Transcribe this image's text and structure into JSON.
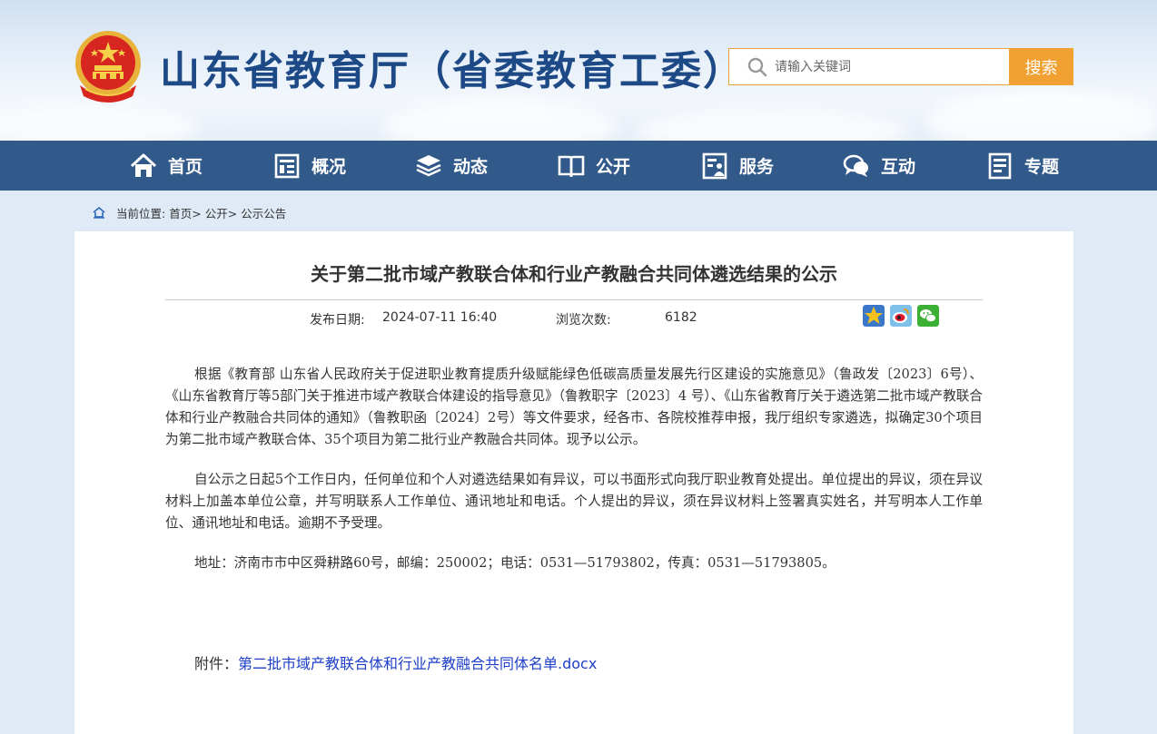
{
  "header": {
    "site_title": "山东省教育厅（省委教育工委）",
    "search_placeholder": "请输入关键词",
    "search_button": "搜索"
  },
  "nav": [
    {
      "label": "首页",
      "icon": "home-icon"
    },
    {
      "label": "概况",
      "icon": "overview-icon"
    },
    {
      "label": "动态",
      "icon": "layers-icon"
    },
    {
      "label": "公开",
      "icon": "book-icon"
    },
    {
      "label": "服务",
      "icon": "service-icon"
    },
    {
      "label": "互动",
      "icon": "chat-icon"
    },
    {
      "label": "专题",
      "icon": "document-icon"
    }
  ],
  "breadcrumb": {
    "prefix": "当前位置:",
    "items": [
      "首页>",
      "公开>",
      "公示公告"
    ]
  },
  "article": {
    "title": "关于第二批市域产教联合体和行业产教融合共同体遴选结果的公示",
    "date_label": "发布日期:",
    "date_value": "2024-07-11 16:40",
    "views_label": "浏览次数:",
    "views_value": "6182",
    "paragraphs": [
      "根据《教育部 山东省人民政府关于促进职业教育提质升级赋能绿色低碳高质量发展先行区建设的实施意见》（鲁政发〔2023〕6号）、《山东省教育厅等5部门关于推进市域产教联合体建设的指导意见》（鲁教职字〔2023〕4 号）、《山东省教育厅关于遴选第二批市域产教联合体和行业产教融合共同体的通知》（鲁教职函〔2024〕2号）等文件要求，经各市、各院校推荐申报，我厅组织专家遴选，拟确定30个项目为第二批市域产教联合体、35个项目为第二批行业产教融合共同体。现予以公示。",
      "自公示之日起5个工作日内，任何单位和个人对遴选结果如有异议，可以书面形式向我厅职业教育处提出。单位提出的异议，须在异议材料上加盖本单位公章，并写明联系人工作单位、通讯地址和电话。个人提出的异议，须在异议材料上签署真实姓名，并写明本人工作单位、通讯地址和电话。逾期不予受理。",
      "地址：济南市市中区舜耕路60号，邮编：250002；电话：0531—51793802，传真：0531—51793805。"
    ],
    "attachment_label": "附件：",
    "attachment_link": "第二批市域产教联合体和行业产教融合共同体名单.docx"
  },
  "share": [
    {
      "icon": "favorite-star-icon",
      "color": "#f2b705"
    },
    {
      "icon": "weibo-icon",
      "color": "#e6162d"
    },
    {
      "icon": "wechat-icon",
      "color": "#3cb034"
    }
  ]
}
